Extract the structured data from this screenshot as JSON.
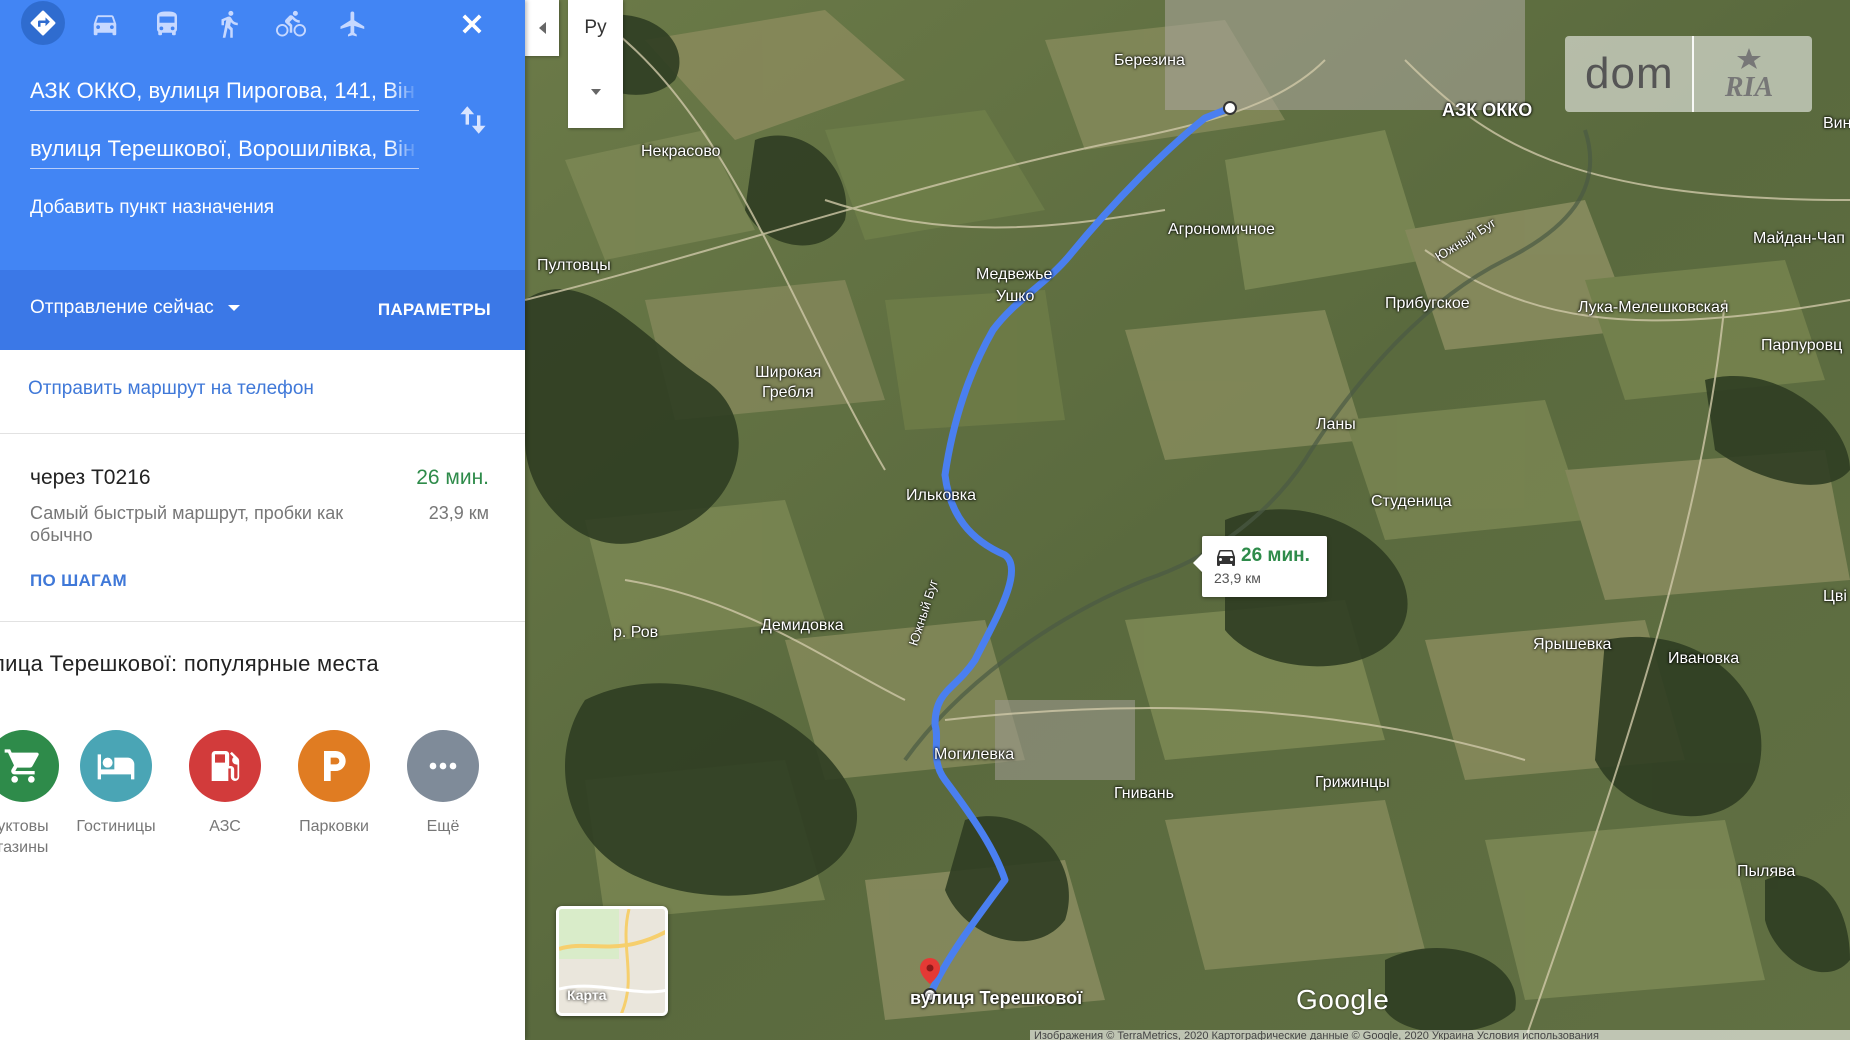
{
  "directions": {
    "modes": [
      {
        "name": "best",
        "icon": "directions-icon",
        "active": true
      },
      {
        "name": "car",
        "icon": "car-icon"
      },
      {
        "name": "transit",
        "icon": "bus-icon"
      },
      {
        "name": "walk",
        "icon": "walking-icon"
      },
      {
        "name": "bike",
        "icon": "bike-icon"
      },
      {
        "name": "flight",
        "icon": "airplane-icon"
      }
    ],
    "origin": "АЗК ОККО, вулиця Пирогова, 141, Він",
    "destination": "вулиця Терешкової, Ворошилівка, Він",
    "add_destination": "Добавить пункт назначения",
    "depart": "Отправление сейчас",
    "params": "ПАРАМЕТРЫ",
    "send_to_phone": "Отправить маршрут на телефон"
  },
  "route": {
    "via": "через Т0216",
    "time": "26 мин.",
    "description": "Самый быстрый маршрут, пробки как обычно",
    "distance": "23,9 км",
    "steps": "ПО ШАГАМ"
  },
  "places": {
    "title": "лица Терешкової: популярные места",
    "items": [
      {
        "label": "уктовы\nгазины",
        "icon": "cart-icon",
        "color": "#2e8b4a"
      },
      {
        "label": "Гостиницы",
        "icon": "bed-icon",
        "color": "#4aa5b5"
      },
      {
        "label": "АЗС",
        "icon": "gas-station-icon",
        "color": "#d23b3b"
      },
      {
        "label": "Парковки",
        "icon": "parking-icon",
        "color": "#e07c22"
      },
      {
        "label": "Ещё",
        "icon": "more-icon",
        "color": "#7f8b99"
      }
    ]
  },
  "map": {
    "map_type_label": "Ру",
    "minimap_label": "Карта",
    "origin_label": "АЗК ОККО",
    "destination_label": "вулиця Терешкової",
    "bubble_time": "26 мин.",
    "bubble_distance": "23,9 км",
    "google": "Google",
    "copyright": "Изображения © TerraMetrics, 2020 Картографические данные © Google, 2020    Украина    Условия использования",
    "watermark_dom": "dom",
    "watermark_ria": "RIA",
    "route_color": "#4a7ff0",
    "place_names": [
      "Березина",
      "Некрасово",
      "Пултовцы",
      "Агрономичное",
      "Медвежье",
      "Ушко",
      "Прибугское",
      "Лука-Мелешковская",
      "Майдан-Чап",
      "Парпуровц",
      "Вин",
      "Широкая",
      "Гребля",
      "Ланы",
      "Ильковка",
      "Студеница",
      "Цвi",
      "Демидовка",
      "р. Ров",
      "Ярышевка",
      "Ивановка",
      "Могилевка",
      "Гнивань",
      "Грижинцы",
      "Пылява",
      "Южный Буг",
      "Южный Буг"
    ]
  }
}
